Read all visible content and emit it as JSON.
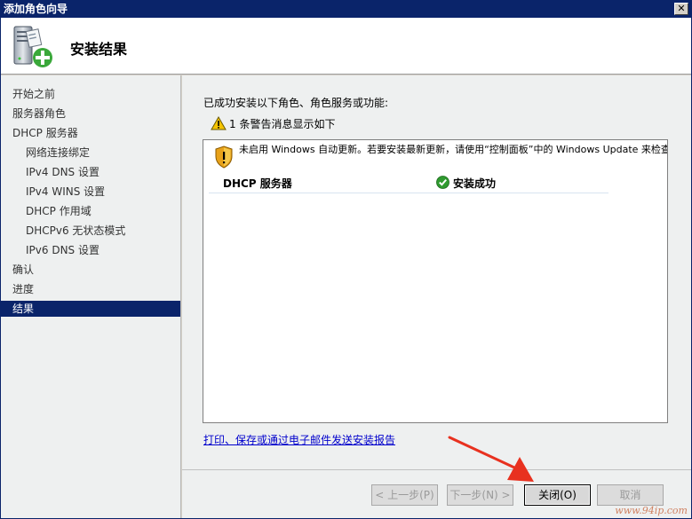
{
  "window": {
    "title": "添加角色向导",
    "close_glyph": "✕"
  },
  "header": {
    "title": "安装结果",
    "icon": "server-add-role-icon"
  },
  "nav": {
    "items": [
      {
        "label": "开始之前",
        "level": 0,
        "active": false
      },
      {
        "label": "服务器角色",
        "level": 0,
        "active": false
      },
      {
        "label": "DHCP 服务器",
        "level": 0,
        "active": false
      },
      {
        "label": "网络连接绑定",
        "level": 1,
        "active": false
      },
      {
        "label": "IPv4 DNS 设置",
        "level": 1,
        "active": false
      },
      {
        "label": "IPv4 WINS 设置",
        "level": 1,
        "active": false
      },
      {
        "label": "DHCP 作用域",
        "level": 1,
        "active": false
      },
      {
        "label": "DHCPv6 无状态模式",
        "level": 1,
        "active": false
      },
      {
        "label": "IPv6 DNS 设置",
        "level": 1,
        "active": false
      },
      {
        "label": "确认",
        "level": 0,
        "active": false
      },
      {
        "label": "进度",
        "level": 0,
        "active": false
      },
      {
        "label": "结果",
        "level": 0,
        "active": true
      }
    ]
  },
  "content": {
    "intro": "已成功安装以下角色、角色服务或功能:",
    "warning_summary": "1 条警告消息显示如下",
    "notice": "未启用 Windows 自动更新。若要安装最新更新，请使用“控制面板”中的 Windows Update 来检查更新。",
    "result": {
      "role": "DHCP 服务器",
      "status": "安装成功"
    },
    "report_link": "打印、保存或通过电子邮件发送安装报告"
  },
  "buttons": {
    "back": "< 上一步(P)",
    "next": "下一步(N) >",
    "close": "关闭(O)",
    "cancel": "取消"
  },
  "watermark": "www.94ip.com",
  "colors": {
    "title_bar": "#0a246a",
    "selected_nav": "#0a246a",
    "link": "#0000cc",
    "arrow": "#e8311f"
  }
}
